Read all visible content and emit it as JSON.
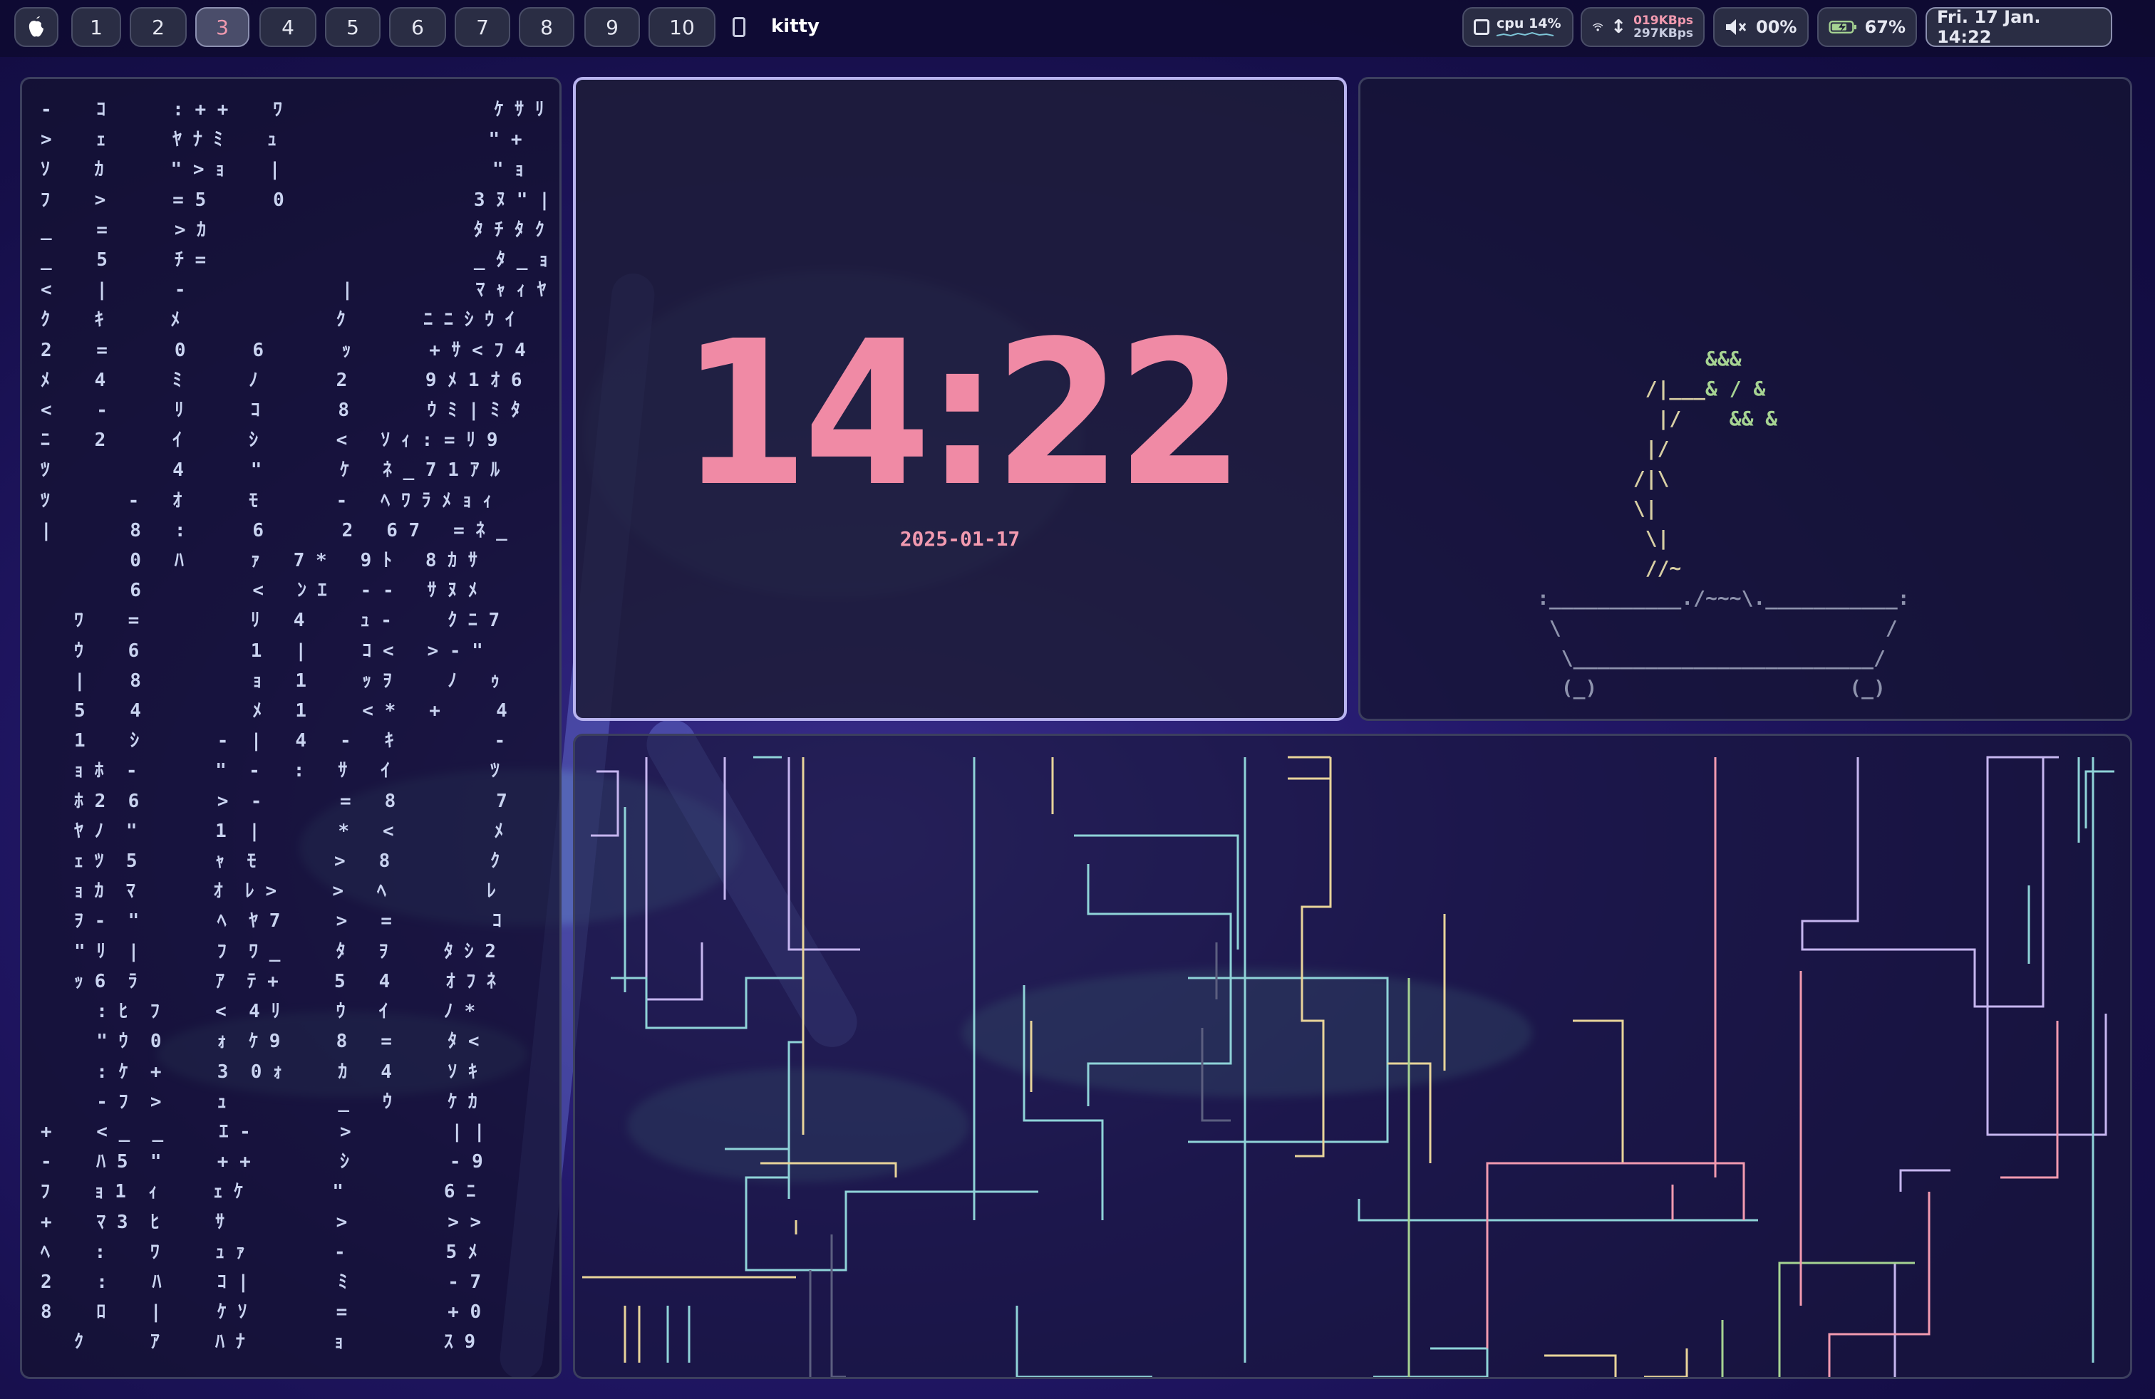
{
  "topbar": {
    "workspaces": [
      "1",
      "2",
      "3",
      "4",
      "5",
      "6",
      "7",
      "8",
      "9",
      "10"
    ],
    "active_workspace": "3",
    "app_name": "kitty",
    "cpu_label": "cpu",
    "cpu_value": "14%",
    "net_up": "019KBps",
    "net_down": "297KBps",
    "volume": "00%",
    "battery": "67%",
    "datetime": "Fri. 17 Jan. 14:22",
    "icons": [
      "apple-icon",
      "terminal-icon",
      "cpu-icon",
      "wifi-icon",
      "updown-arrow-icon",
      "speaker-muted-icon",
      "battery-charging-icon"
    ]
  },
  "matrix": {
    "text": "-    ｺ      : + +    ﾜ                   ｹ ｻ ﾘ\n>    ｪ      ﾔ ﾅ ﾐ    ｭ                   \" +\nｿ    ｶ      \" > ｮ    |                   \" ｮ\nﾌ    >      = 5      0                 3 ﾇ \" |\n_    =      > ｶ                        ﾀ ﾁ ﾀ ｸ\n_    5      ﾁ =                        _ ﾀ _ ｮ\n<    |      -              |           ﾏ ｬ ｨ ﾔ\nｸ    ｷ      ﾒ              ｸ       ﾆ ﾆ ｼ ｳ ｲ\n2    =      0      6       ｯ       + ｻ < ﾌ 4\nﾒ    4      ﾐ      ﾉ       2       9 ﾒ 1 ｵ 6\n<    -      ﾘ      ｺ       8       ｳ ﾐ | ﾐ ﾀ\nﾆ    2      ｲ      ｼ       <   ｿ ｨ : = ﾘ 9\nﾂ           4      \"       ｹ   ﾈ _ 7 1 ｱ ﾙ\nﾂ       -   ｵ      ﾓ       -   ﾍ ﾜ ﾗ ﾒ ｮ ｨ\n|       8   :      6       2   6 7   = ﾈ _\n        0   ﾊ      ｧ   7 *   9 ﾄ   8 ｶ ｻ\n        6          <   ﾝ ｴ   - -   ｻ ﾇ ﾒ\n   ﾜ    =          ﾘ   4     ｭ -     ｸ ﾆ 7\n   ｳ    6          1   |     ｺ <   > - \"\n   |    8          ｮ   1     ｯ ｦ     ﾉ   ｩ\n   5    4          ﾒ   1     < *   +     4\n   1    ｼ       -  |   4   -   ｷ         -\n   ｮ ﾎ  -       \"  -   :   ｻ   ｲ         ﾂ\n   ﾎ 2  6       >  -       =   8         7\n   ﾔ ﾉ  \"       1  |       *   <         ﾒ\n   ｪ ﾂ  5       ｬ  ﾓ       >   8         ｸ\n   ｮ ｶ  ﾏ       ｵ  ﾚ >     >   ﾍ         ﾚ\n   ｦ -  \"       ﾍ  ﾔ 7     >   =         ｺ\n   \" ﾘ  |       ﾌ  ﾜ _     ﾀ   ｦ     ﾀ ｼ 2\n   ｯ 6  ﾗ       ｱ  ﾃ +     5   4     ｵ ﾌ ﾈ\n     : ﾋ  ﾌ     <  4 ﾘ     ｳ   ｲ     ﾉ *\n     \" ｳ  0     ｫ  ｹ 9     8   =     ﾀ <\n     : ｹ  +     3  0 ｫ     ｶ   4     ｿ ｷ\n     - ﾌ  >     ｭ          _   ｳ     ｹ ｶ\n+    < _  _     ｴ -        >         | |\n-    ﾊ 5  \"     + +        ｼ         - 9\nﾌ    ｮ 1  ｨ     ｪ ｹ        \"         6 ﾆ\n+    ﾏ 3  ﾋ     ｻ          >         > >\nﾍ    :    ﾜ     ｭ ｧ        -         5 ﾒ\n2    :    ﾊ     ｺ |        ﾐ         - 7\n8    ﾛ    |     ｹ ｿ        =         + 0\n   ｸ      ｱ     ﾊ ﾅ        ｮ         ｽ 9"
  },
  "clock": {
    "time": "14:22",
    "date": "2025-01-17"
  },
  "bonsai": {
    "lines": [
      {
        "trunk": "              ",
        "leaves": "&&&"
      },
      {
        "trunk": "         /|___",
        "leaves": "& / &"
      },
      {
        "trunk": "          |/    ",
        "leaves": "&& &"
      },
      {
        "trunk": "         |/",
        "leaves": ""
      },
      {
        "trunk": "        /|\\",
        "leaves": ""
      },
      {
        "trunk": "        \\|",
        "leaves": ""
      },
      {
        "trunk": "         \\|",
        "leaves": ""
      },
      {
        "trunk": "         //~",
        "leaves": ""
      }
    ],
    "pot": [
      ":___________./~~~\\.___________:",
      " \\                           /",
      "  \\_________________________/",
      "  (_)                     (_)"
    ]
  },
  "colors": {
    "clock": "#f08aa5",
    "active_border": "#b9b4f0",
    "pipe_teal": "#8fd3d8",
    "pipe_pink": "#f29ab0",
    "pipe_lavender": "#c6b6f0",
    "pipe_yellow": "#e8d49a"
  }
}
